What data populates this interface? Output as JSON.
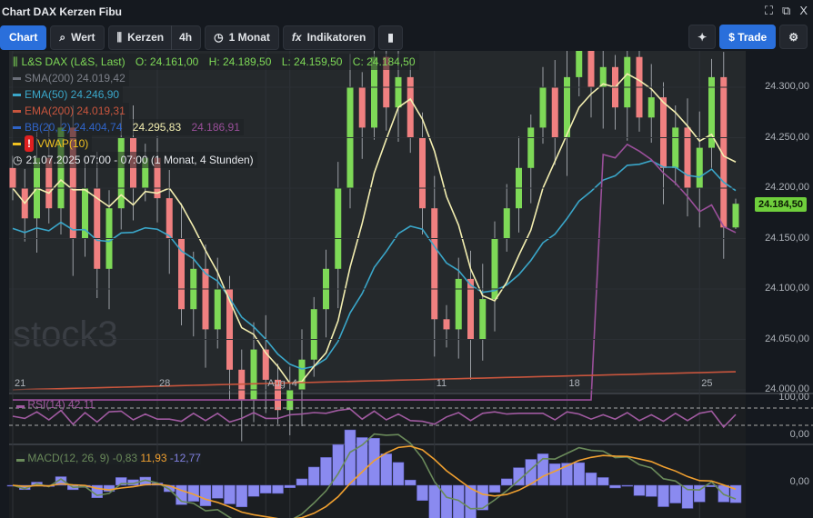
{
  "window": {
    "title": "Chart DAX Kerzen Fibu",
    "icons": [
      "fullscreen-icon",
      "popout-icon",
      "close-icon"
    ],
    "close_label": "X"
  },
  "toolbar": {
    "chart": "Chart",
    "search": "Wert",
    "type": "Kerzen",
    "interval": "4h",
    "range": "1 Monat",
    "indicators": "Indikatoren",
    "trade": "$ Trade",
    "fx": "fx"
  },
  "legend": {
    "main": "L&S DAX (L&S, Last)",
    "o": "O: 24.161,00",
    "h": "H: 24.189,50",
    "l": "L: 24.159,50",
    "c": "C: 24.184,50",
    "sma200": "SMA(200) 24.019,42",
    "ema50": "EMA(50) 24.246,90",
    "ema200": "EMA(200) 24.019,31",
    "bb": "BB(20, 2) 24.404,74",
    "bb_mid": "24.295,83",
    "bb_low": "24.186,91",
    "vwap": "VWAP(10)",
    "time": "21.07.2025 07:00 - 07:00  (1 Monat, 4 Stunden)"
  },
  "colors": {
    "up": "#7ed957",
    "down": "#f08080",
    "ema50": "#3aa6c9",
    "bbmid": "#f3eeb0",
    "bblow": "#9a4f9a",
    "accent": "#2a6fdb"
  },
  "price_axis": [
    "24.300,00",
    "24.250,00",
    "24.200,00",
    "24.150,00",
    "24.100,00",
    "24.050,00",
    "24.000,00"
  ],
  "last_price": "24.184,50",
  "watermark": "stock3",
  "x_labels": [
    {
      "t": "21",
      "i": 0
    },
    {
      "t": "28",
      "i": 12
    },
    {
      "t": "Aug",
      "i": 21
    },
    {
      "t": "4",
      "i": 23
    },
    {
      "t": "11",
      "i": 35
    },
    {
      "t": "18",
      "i": 46
    },
    {
      "t": "25",
      "i": 57
    }
  ],
  "chart_data": {
    "type": "candlestick",
    "ylim": [
      24000,
      24330
    ],
    "closes": [
      24200,
      24170,
      24230,
      24180,
      24260,
      24150,
      24200,
      24120,
      24180,
      24250,
      24200,
      24230,
      24190,
      24150,
      24080,
      24120,
      24060,
      24100,
      24020,
      23990,
      24040,
      24010,
      23980,
      24000,
      24030,
      24080,
      24120,
      24200,
      24300,
      24260,
      24330,
      24280,
      24310,
      24250,
      24180,
      24070,
      24060,
      24110,
      24050,
      24090,
      24150,
      24180,
      24220,
      24260,
      24300,
      24250,
      24310,
      24340,
      24300,
      24320,
      24280,
      24330,
      24270,
      24290,
      24220,
      24260,
      24200,
      24240,
      24310,
      24161,
      24184.5
    ],
    "last_ohlc": [
      24161,
      24189.5,
      24159.5,
      24184.5
    ]
  },
  "rsi": {
    "label": "RSI(14) 42,11",
    "axis": [
      "100,00",
      "0,00"
    ]
  },
  "macd": {
    "label": "MACD(12, 26, 9)",
    "v1": "-0,83",
    "v2": "11,93",
    "v3": "-12,77",
    "axis": "0,00"
  }
}
